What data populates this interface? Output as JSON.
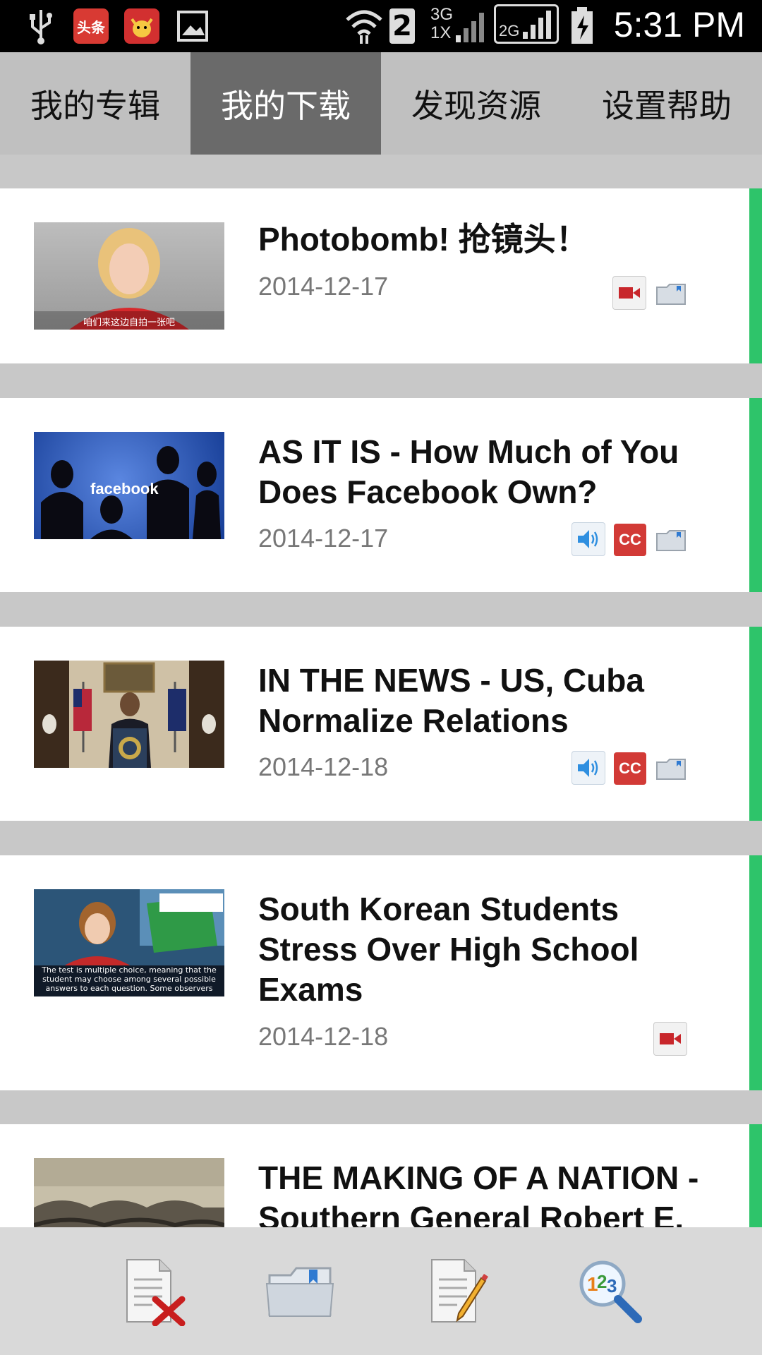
{
  "status_bar": {
    "time": "5:31 PM",
    "app1_label": "头条",
    "network_3g": "3G",
    "network_1x": "1X",
    "network_2g": "2G",
    "sim_slot": "2"
  },
  "tabs": [
    {
      "label": "我的专辑",
      "active": false
    },
    {
      "label": "我的下载",
      "active": true
    },
    {
      "label": "发现资源",
      "active": false
    },
    {
      "label": "设置帮助",
      "active": false
    }
  ],
  "items": [
    {
      "title": "Photobomb! 抢镜头！",
      "date": "2014-12-17",
      "badges": [
        "video",
        "folder"
      ],
      "thumb_caption": "咱们来这边自拍一张吧"
    },
    {
      "title": "AS IT IS - How Much of You Does Facebook Own?",
      "date": "2014-12-17",
      "badges": [
        "audio",
        "cc",
        "folder"
      ],
      "thumb_caption": "facebook"
    },
    {
      "title": "IN THE NEWS - US, Cuba Normalize Relations",
      "date": "2014-12-18",
      "badges": [
        "audio",
        "cc",
        "folder"
      ],
      "thumb_caption": ""
    },
    {
      "title": "South Korean Students Stress Over High School Exams",
      "date": "2014-12-18",
      "badges": [
        "video"
      ],
      "thumb_caption": "The test is multiple choice, meaning that the student may choose among several possible answers to each question. Some observers"
    },
    {
      "title": "THE MAKING OF A NATION - Southern General Robert E.",
      "date": "",
      "badges": [],
      "thumb_caption": ""
    }
  ],
  "badge_labels": {
    "cc": "CC"
  },
  "bottom_bar": [
    {
      "name": "delete-document-icon"
    },
    {
      "name": "folder-icon"
    },
    {
      "name": "edit-document-icon"
    },
    {
      "name": "search-123-icon"
    }
  ],
  "colors": {
    "accent_stripe": "#2ec46a",
    "active_tab": "#6a6a6a",
    "cc_red": "#d23a36"
  }
}
